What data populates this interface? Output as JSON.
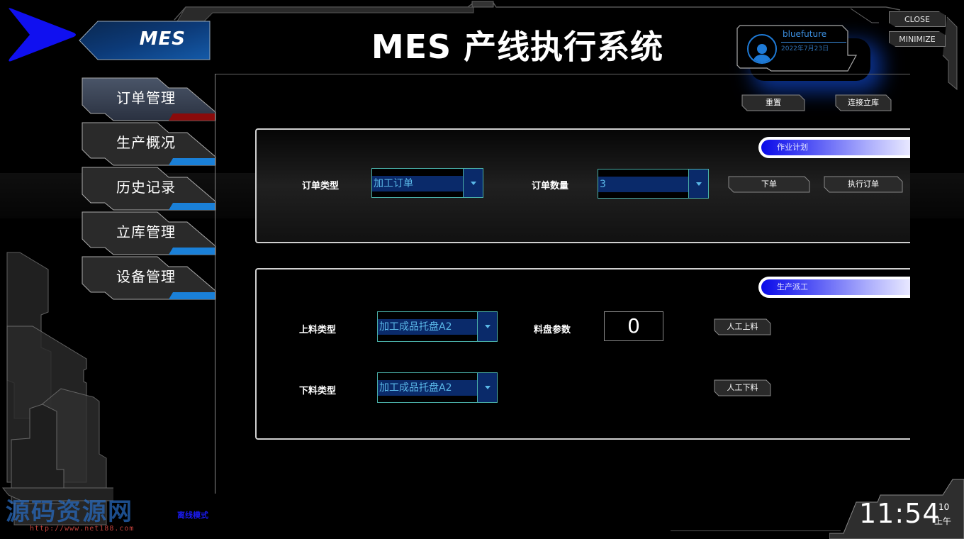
{
  "app": {
    "logo_text": "MES",
    "title": "MES 产线执行系统"
  },
  "user": {
    "name": "bluefuture",
    "date": "2022年7月23日",
    "icon": "user-avatar-icon"
  },
  "window_controls": {
    "close_label": "CLOSE",
    "minimize_label": "MINIMIZE"
  },
  "sidebar": {
    "items": [
      {
        "label": "订单管理",
        "active": true
      },
      {
        "label": "生产概况",
        "active": false
      },
      {
        "label": "历史记录",
        "active": false
      },
      {
        "label": "立库管理",
        "active": false
      },
      {
        "label": "设备管理",
        "active": false
      }
    ]
  },
  "toolbar": {
    "reset_label": "重置",
    "connect_label": "连接立库"
  },
  "work_plan": {
    "title": "作业计划",
    "order_type_label": "订单类型",
    "order_type_value": "加工订单",
    "order_qty_label": "订单数量",
    "order_qty_value": "3",
    "place_order_label": "下单",
    "execute_order_label": "执行订单"
  },
  "dispatch": {
    "title": "生产派工",
    "load_type_label": "上料类型",
    "load_type_value": "加工成品托盘A2",
    "tray_param_label": "料盘参数",
    "tray_param_value": "0",
    "manual_load_label": "人工上料",
    "unload_type_label": "下料类型",
    "unload_type_value": "加工成品托盘A2",
    "manual_unload_label": "人工下料"
  },
  "status": {
    "mode": "离线模式"
  },
  "watermark": {
    "text": "源码资源网",
    "url": "http://www.net188.com"
  },
  "clock": {
    "time": "11:54",
    "seconds": "10",
    "ampm": "上午"
  },
  "colors": {
    "accent_blue": "#1e7ad6",
    "active_red": "#8a0a0a",
    "combo_text": "#5ab8e8"
  }
}
